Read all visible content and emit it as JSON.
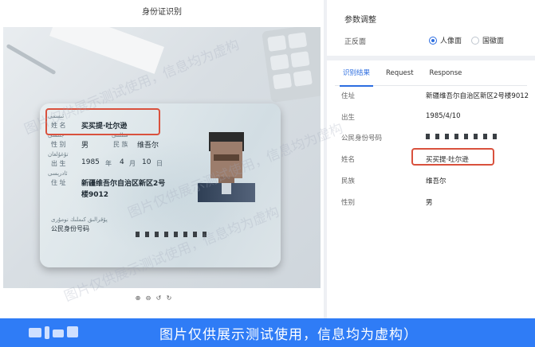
{
  "left_panel": {
    "title": "身份证识别",
    "card": {
      "name_label": "姓 名",
      "name_value": "买买提·吐尔逊",
      "gender_label": "性 别",
      "gender_value": "男",
      "ethnicity_label": "民 族",
      "ethnicity_value": "维吾尔",
      "birth_label": "出 生",
      "birth_year": "1985",
      "birth_year_unit": "年",
      "birth_month": "4",
      "birth_month_unit": "月",
      "birth_day": "10",
      "birth_day_unit": "日",
      "address_label": "住 址",
      "address_line1": "新疆维吾尔自治区新区2号",
      "address_line2": "楼9012",
      "id_label": "公民身份号码"
    },
    "zoom_tools": [
      "zoom-in-icon",
      "zoom-out-icon",
      "rotate-left-icon",
      "rotate-right-icon"
    ]
  },
  "right_panel": {
    "section_title": "参数调整",
    "side_label": "正反面",
    "options": [
      {
        "label": "人像面",
        "selected": true
      },
      {
        "label": "国徽面",
        "selected": false
      }
    ],
    "tabs": [
      "识别结果",
      "Request",
      "Response"
    ],
    "active_tab": "识别结果",
    "fields": [
      {
        "key": "住址",
        "value": "新疆维吾尔自治区新区2号楼9012"
      },
      {
        "key": "出生",
        "value": "1985/4/10"
      },
      {
        "key": "公民身份号码",
        "value": ""
      },
      {
        "key": "姓名",
        "value": "买买提·吐尔逊"
      },
      {
        "key": "民族",
        "value": "维吾尔"
      },
      {
        "key": "性别",
        "value": "男"
      }
    ]
  },
  "watermark": "图片仅供展示测试使用，信息均为虚构",
  "banner": {
    "text": "图片仅供展示测试使用，信息均为虚构）"
  },
  "colors": {
    "accent": "#2c6de0",
    "highlight": "#d9513d",
    "banner": "#2f7cf6"
  }
}
